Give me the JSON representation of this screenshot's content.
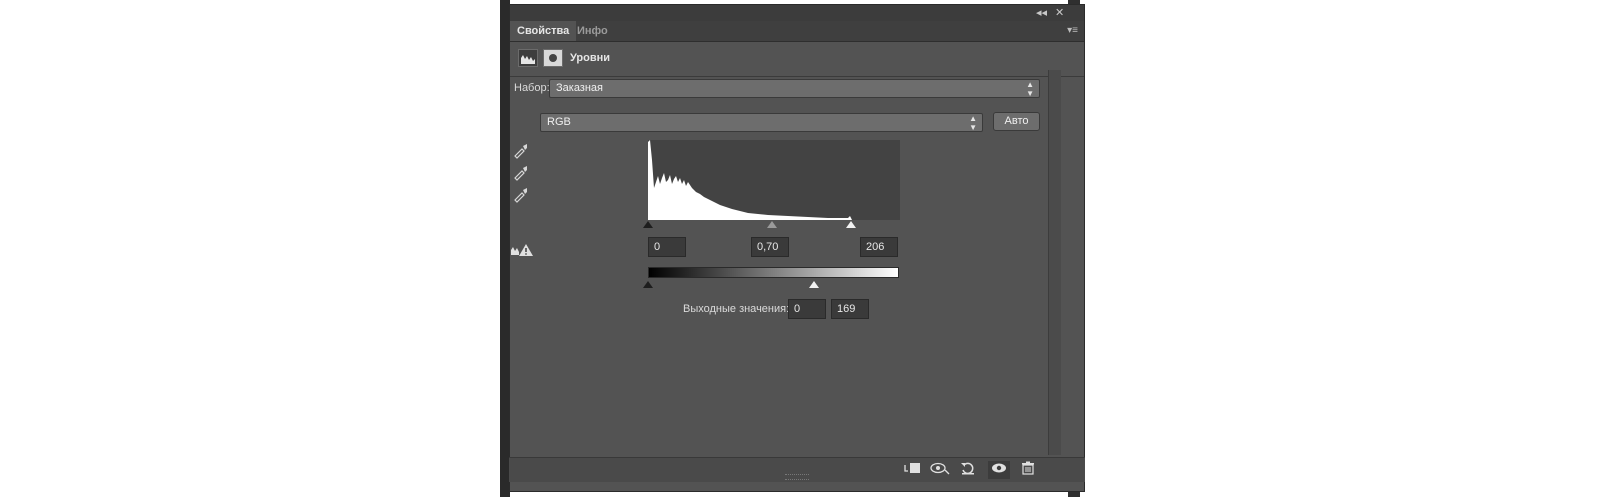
{
  "window_controls": {
    "collapse": "◂◂",
    "close": "✕"
  },
  "tabs": [
    {
      "label": "Свойства",
      "active": true
    },
    {
      "label": "Инфо",
      "active": false
    }
  ],
  "header": {
    "title": "Уровни",
    "icons": [
      "histogram-icon",
      "mask-icon"
    ]
  },
  "preset": {
    "label": "Набор:",
    "value": "Заказная"
  },
  "channel": {
    "value": "RGB"
  },
  "auto_button": {
    "label": "Авто"
  },
  "eyedroppers": [
    "black-point-eyedropper-icon",
    "gray-point-eyedropper-icon",
    "white-point-eyedropper-icon"
  ],
  "input_levels": {
    "black": "0",
    "gamma": "0,70",
    "white": "206"
  },
  "output_levels": {
    "label": "Выходные значения:",
    "black": "0",
    "white": "169"
  },
  "footer_icons": [
    "clip-to-layer-icon",
    "view-previous-icon",
    "reset-icon",
    "visibility-icon",
    "delete-icon"
  ],
  "colors": {
    "panel": "#535353",
    "field": "#3a3a3a",
    "histogram_bg": "#434343",
    "histogram_fill": "#ffffff"
  },
  "histogram": {
    "shape": "left-skewed, peak near 0, tail to 206"
  }
}
